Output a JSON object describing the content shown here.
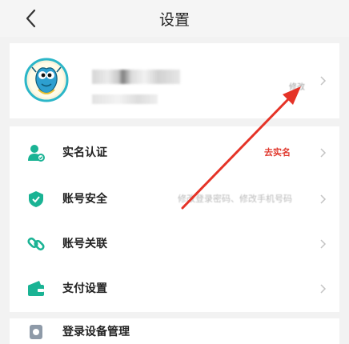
{
  "header": {
    "title": "设置"
  },
  "profile": {
    "edit_label": "修改"
  },
  "menu": [
    {
      "label": "实名认证",
      "value": "去实名",
      "value_color": "#e03a2f",
      "icon": "user-verify-icon"
    },
    {
      "label": "账号安全",
      "value": "修改登录密码、修改手机号码",
      "value_color": "#b9b9b9",
      "icon": "shield-check-icon"
    },
    {
      "label": "账号关联",
      "value": "",
      "icon": "link-icon"
    },
    {
      "label": "支付设置",
      "value": "",
      "icon": "wallet-icon"
    },
    {
      "label": "登录设备管理",
      "value": "",
      "icon": "device-icon"
    }
  ],
  "colors": {
    "accent": "#1ab394",
    "arrow": "#e53327"
  }
}
